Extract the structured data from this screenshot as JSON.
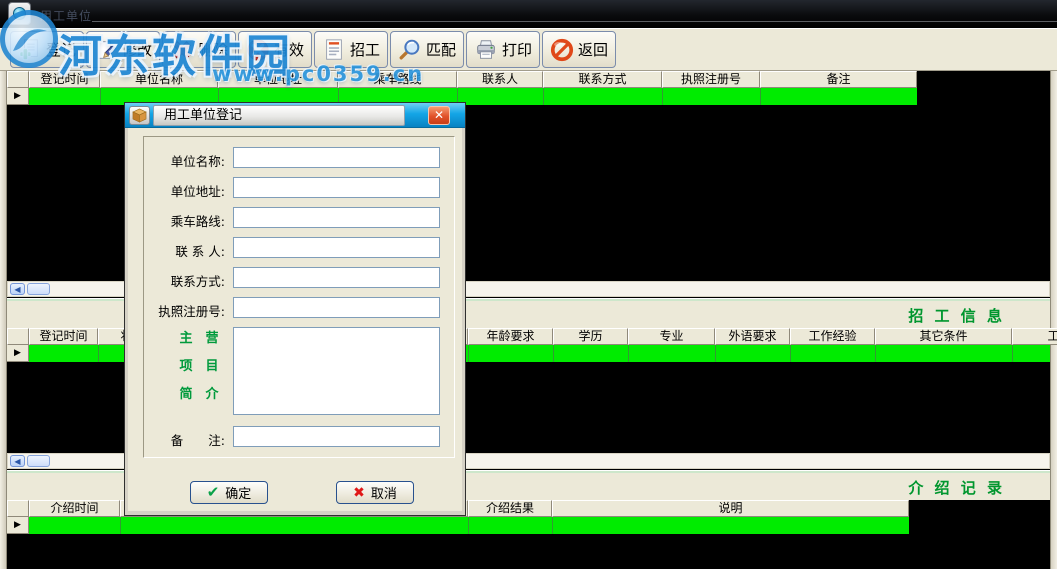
{
  "window": {
    "title": "用工单位",
    "watermark": {
      "site_name": "河东软件园",
      "site_url": "www.pc0359.cn"
    }
  },
  "toolbar": {
    "buttons": [
      {
        "label": "登记",
        "icon": "register-icon"
      },
      {
        "label": "修改",
        "icon": "edit-icon"
      },
      {
        "label": "删除",
        "icon": "delete-icon"
      },
      {
        "label": "有效",
        "icon": "valid-icon"
      },
      {
        "label": "招工",
        "icon": "recruit-icon"
      },
      {
        "label": "匹配",
        "icon": "match-icon"
      },
      {
        "label": "打印",
        "icon": "print-icon"
      },
      {
        "label": "返回",
        "icon": "return-icon"
      }
    ]
  },
  "employer_table": {
    "columns": [
      "登记时间",
      "单位名称",
      "单位地址",
      "乘车路线",
      "联系人",
      "联系方式",
      "执照注册号",
      "备注"
    ]
  },
  "recruit_section": {
    "title": "招 工 信 息",
    "columns": [
      "登记时间",
      "状",
      "年龄要求",
      "学历",
      "专业",
      "外语要求",
      "工作经验",
      "其它条件",
      "工资"
    ]
  },
  "intro_section": {
    "title": "介 绍 记 录",
    "columns": [
      "介绍时间",
      "介绍结果",
      "说明"
    ]
  },
  "dialog": {
    "title": "用工单位登记",
    "fields": [
      {
        "label": "单位名称:",
        "value": ""
      },
      {
        "label": "单位地址:",
        "value": ""
      },
      {
        "label": "乘车路线:",
        "value": ""
      },
      {
        "label": "联 系 人:",
        "value": ""
      },
      {
        "label": "联系方式:",
        "value": ""
      },
      {
        "label": "执照注册号:",
        "value": ""
      }
    ],
    "textarea_label_lines": [
      "主　营",
      "项　目",
      "简　介"
    ],
    "textarea_value": "",
    "note_label": "备　　注:",
    "note_value": "",
    "ok_label": "确定",
    "cancel_label": "取消"
  },
  "icons": {
    "row_selector": "▶",
    "scroll_left_arrow": "◀",
    "ok_check": "✔",
    "cancel_cross": "✖",
    "close_x": "✕"
  },
  "colors": {
    "selected_row": "#00EC00",
    "section_title_green": "#00962E",
    "dialog_titlebar_cyan": "#14A5E6",
    "panel_beige": "#ECE9D8"
  }
}
